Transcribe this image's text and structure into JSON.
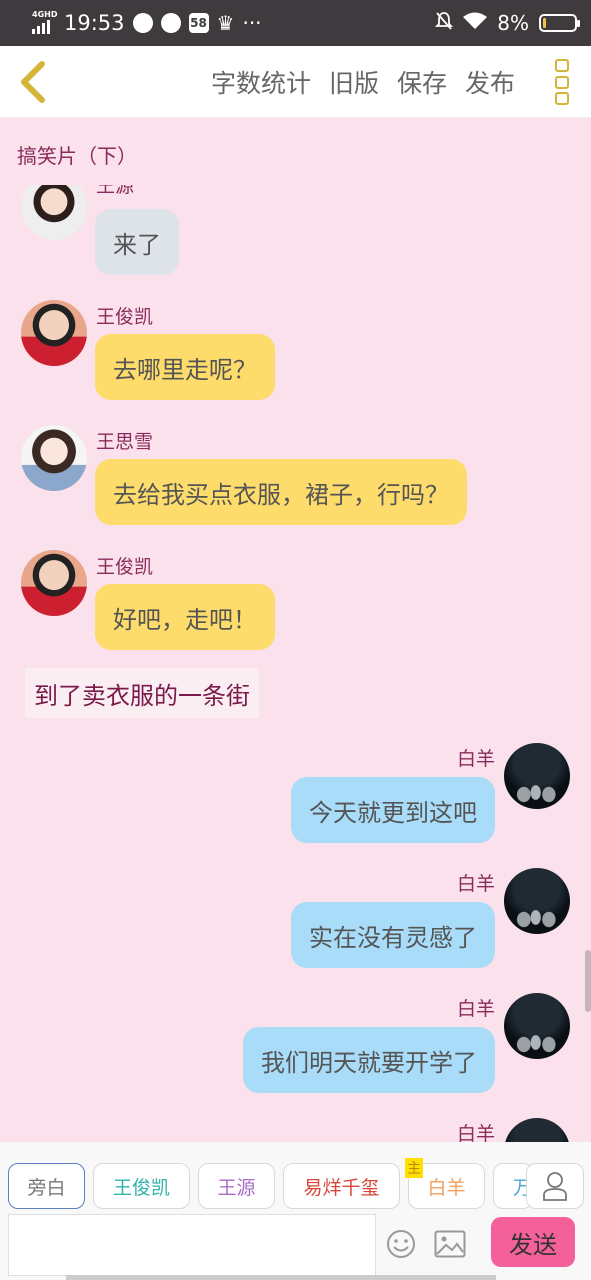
{
  "status_bar": {
    "network": "4GHD",
    "time": "19:53",
    "app_badge": "58",
    "more": "···",
    "battery_text": "8%",
    "battery_level": 0.08,
    "battery_color": "#f5c542"
  },
  "toolbar": {
    "back_icon": "chevron-left-icon",
    "actions": [
      "字数统计",
      "旧版",
      "保存",
      "发布"
    ],
    "menu_icon": "more-vertical-icon"
  },
  "story_title": "搞笑片（下）",
  "messages": [
    {
      "sender": "王源",
      "text": "来了",
      "side": "left",
      "color": "#dde3e8"
    },
    {
      "sender": "王俊凯",
      "text": "去哪里走呢？",
      "side": "left",
      "color": "#fddc6c"
    },
    {
      "sender": "王思雪",
      "text": "去给我买点衣服，裙子，行吗？",
      "side": "left",
      "color": "#fddc6c"
    },
    {
      "sender": "王俊凯",
      "text": "好吧，走吧！",
      "side": "left",
      "color": "#fddc6c"
    },
    {
      "narration": "到了卖衣服的一条街"
    },
    {
      "sender": "白羊",
      "text": "今天就更到这吧",
      "side": "right",
      "color": "#a8dcf8"
    },
    {
      "sender": "白羊",
      "text": "实在没有灵感了",
      "side": "right",
      "color": "#a8dcf8"
    },
    {
      "sender": "白羊",
      "text": "我们明天就要开学了",
      "side": "right",
      "color": "#a8dcf8"
    },
    {
      "sender": "白羊",
      "text": "",
      "side": "right",
      "color": "#a8dcf8"
    }
  ],
  "roles": [
    {
      "label": "旁白",
      "color": "#777777",
      "active": true
    },
    {
      "label": "王俊凯",
      "color": "#2fb3a8"
    },
    {
      "label": "王源",
      "color": "#a86cc6"
    },
    {
      "label": "易烊千玺",
      "color": "#d9473a"
    },
    {
      "label": "白羊",
      "color": "#f0a060",
      "badge": "主"
    },
    {
      "label": "万",
      "color": "#4aa3d8"
    }
  ],
  "composer": {
    "input_value": "",
    "input_placeholder": "",
    "emoji_icon": "smiley-icon",
    "image_icon": "image-icon",
    "send_label": "发送",
    "person_icon": "person-icon"
  }
}
